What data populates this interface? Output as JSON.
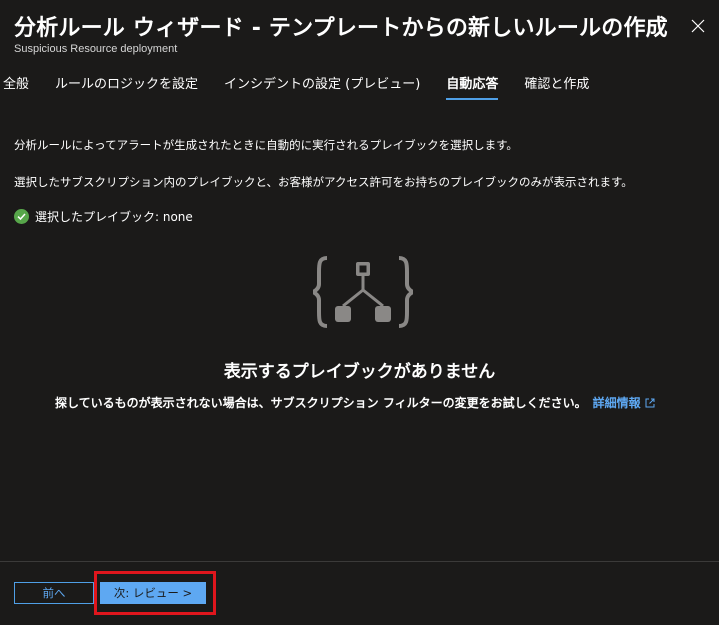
{
  "header": {
    "title": "分析ルール ウィザード - テンプレートからの新しいルールの作成",
    "subtitle": "Suspicious Resource deployment"
  },
  "tabs": [
    {
      "label": "全般"
    },
    {
      "label": "ルールのロジックを設定"
    },
    {
      "label": "インシデントの設定 (プレビュー)"
    },
    {
      "label": "自動応答"
    },
    {
      "label": "確認と作成"
    }
  ],
  "content": {
    "description1": "分析ルールによってアラートが生成されたときに自動的に実行されるプレイブックを選択します。",
    "description2": "選択したサブスクリプション内のプレイブックと、お客様がアクセス許可をお持ちのプレイブックのみが表示されます。",
    "selected_playbook": "選択したプレイブック: none",
    "empty_title": "表示するプレイブックがありません",
    "empty_desc": "探しているものが表示されない場合は、サブスクリプション フィルターの変更をお試しください。",
    "learn_more": "詳細情報"
  },
  "footer": {
    "prev_label": "前へ",
    "next_label": "次: レビュー >"
  },
  "colors": {
    "accent": "#5ea8f2",
    "success": "#57a64a",
    "highlight": "#e0161d"
  }
}
